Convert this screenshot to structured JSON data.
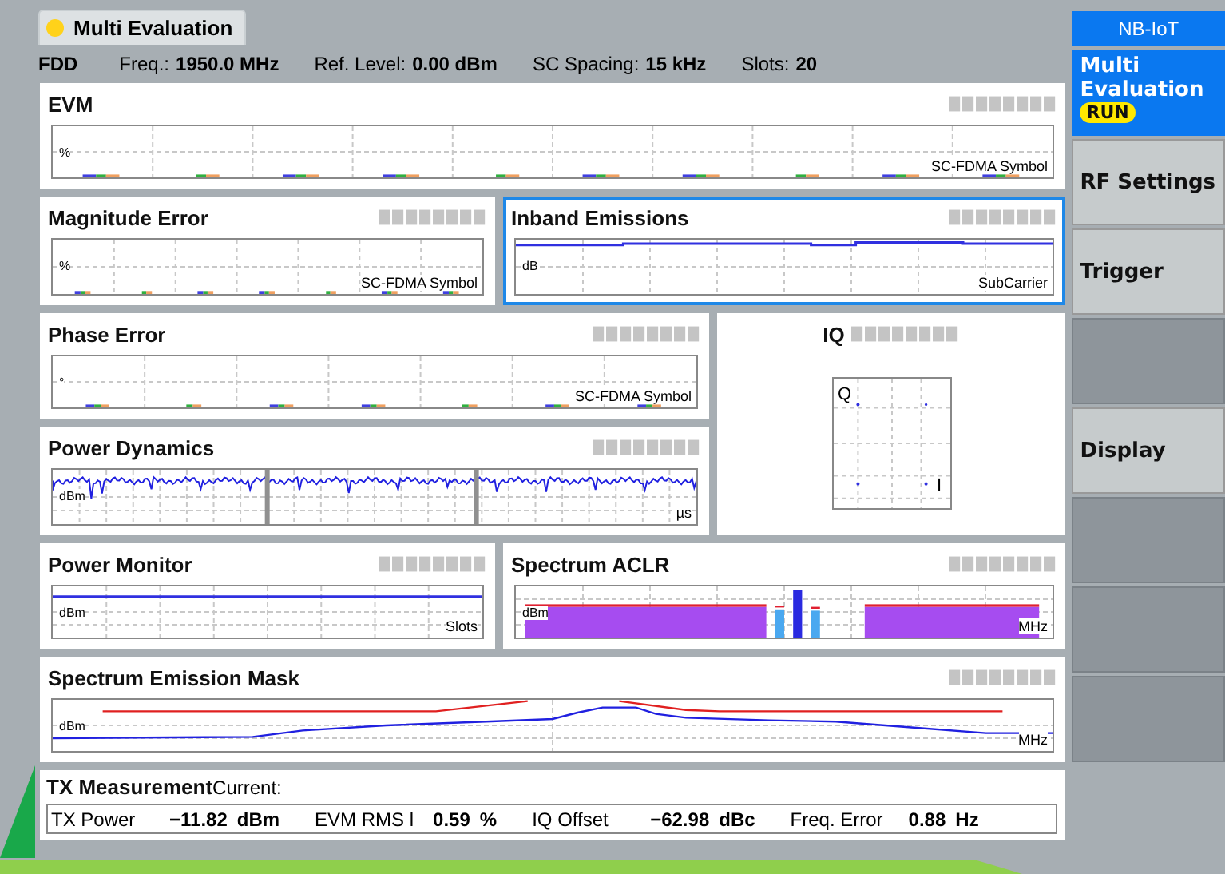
{
  "tab": {
    "label": "Multi Evaluation",
    "selected": true
  },
  "info": {
    "mode": "FDD",
    "fields": [
      {
        "label": "Freq.:",
        "value": "1950.0 MHz"
      },
      {
        "label": "Ref. Level:",
        "value": "0.00 dBm"
      },
      {
        "label": "SC Spacing:",
        "value": "15 kHz"
      },
      {
        "label": "Slots:",
        "value": "20"
      }
    ]
  },
  "panels": [
    {
      "title": "EVM",
      "kind": "bars",
      "unit": "%",
      "axis_label": "SC-FDMA Symbol",
      "selected": false
    },
    {
      "title": "Magnitude Error",
      "kind": "bars",
      "unit": "%",
      "axis_label": "SC-FDMA Symbol",
      "selected": false
    },
    {
      "title": "Inband Emissions",
      "kind": "steps",
      "unit": "dB",
      "axis_label": "SubCarrier",
      "selected": true
    },
    {
      "title": "Phase Error",
      "kind": "bars",
      "unit": "°",
      "axis_label": "SC-FDMA Symbol",
      "selected": false
    },
    {
      "title": "IQ",
      "kind": "iq",
      "unit": "Q",
      "axis_label": "I",
      "selected": false
    },
    {
      "title": "Power Dynamics",
      "kind": "noise",
      "unit": "dBm",
      "axis_label": "µs",
      "selected": false
    },
    {
      "title": "Power Monitor",
      "kind": "flat",
      "unit": "dBm",
      "axis_label": "Slots",
      "selected": false
    },
    {
      "title": "Spectrum ACLR",
      "kind": "aclr",
      "unit": "dBm",
      "axis_label": "MHz",
      "selected": false
    },
    {
      "title": "Spectrum Emission Mask",
      "kind": "mask",
      "unit": "dBm",
      "axis_label": "MHz",
      "selected": false
    }
  ],
  "tx": {
    "title": "TX Measurement",
    "mode": "Current:",
    "results": [
      {
        "label": "TX Power",
        "value": "−11.82",
        "unit": "dBm"
      },
      {
        "label": "EVM RMS l",
        "value": "0.59",
        "unit": "%"
      },
      {
        "label": "IQ Offset",
        "value": "−62.98",
        "unit": "dBc"
      },
      {
        "label": "Freq. Error",
        "value": "0.88",
        "unit": "Hz"
      }
    ]
  },
  "softkeys": {
    "title": "NB-IoT",
    "keys": [
      {
        "kind": "key",
        "label": "Multi Evaluation",
        "badge": "RUN",
        "selected": true
      },
      {
        "kind": "key",
        "label": "RF Settings",
        "selected": false
      },
      {
        "kind": "key",
        "label": "Trigger",
        "selected": false
      },
      {
        "kind": "empty"
      },
      {
        "kind": "key",
        "label": "Display",
        "selected": false
      },
      {
        "kind": "empty"
      },
      {
        "kind": "empty"
      },
      {
        "kind": "empty"
      }
    ]
  }
}
